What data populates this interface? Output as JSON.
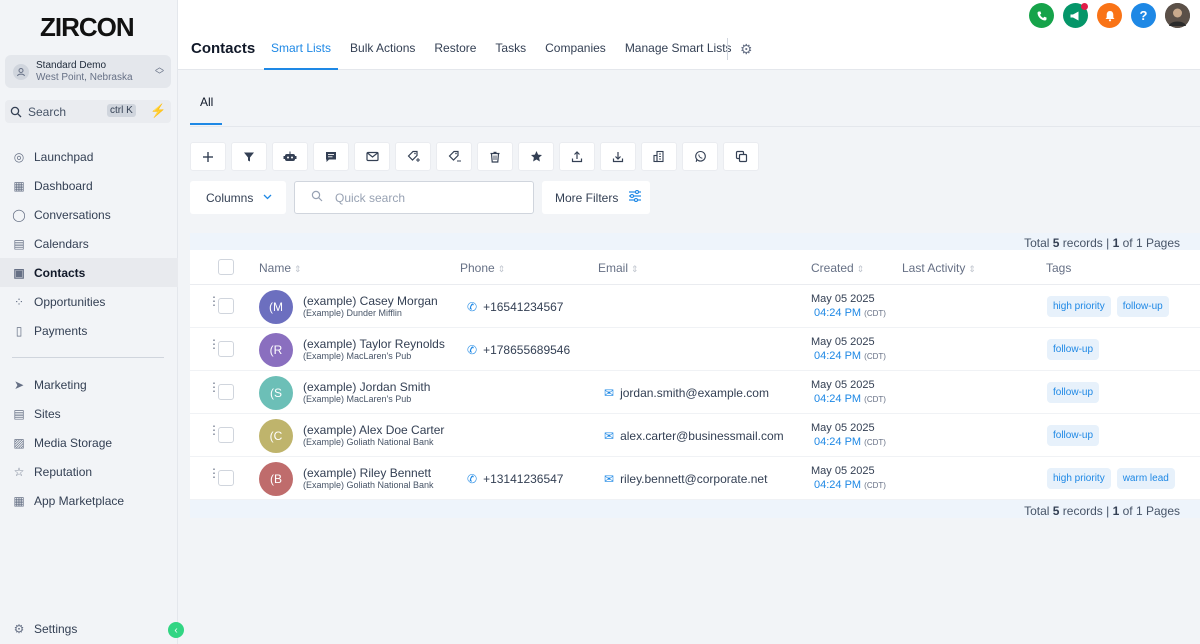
{
  "brand": {
    "logo": "ZIRCON"
  },
  "account": {
    "name": "Standard Demo",
    "location": "West Point, Nebraska"
  },
  "search": {
    "label": "Search",
    "shortcut": "ctrl K"
  },
  "sidebar": {
    "items": [
      {
        "label": "Launchpad",
        "icon": "rocket-icon"
      },
      {
        "label": "Dashboard",
        "icon": "grid-icon"
      },
      {
        "label": "Conversations",
        "icon": "chat-icon"
      },
      {
        "label": "Calendars",
        "icon": "calendar-icon"
      },
      {
        "label": "Contacts",
        "icon": "contacts-icon",
        "active": true
      },
      {
        "label": "Opportunities",
        "icon": "pipeline-icon"
      },
      {
        "label": "Payments",
        "icon": "receipt-icon"
      }
    ],
    "items2": [
      {
        "label": "Marketing",
        "icon": "send-icon"
      },
      {
        "label": "Sites",
        "icon": "sites-icon"
      },
      {
        "label": "Media Storage",
        "icon": "image-icon"
      },
      {
        "label": "Reputation",
        "icon": "star-icon"
      },
      {
        "label": "App Marketplace",
        "icon": "apps-icon"
      }
    ],
    "settings": "Settings"
  },
  "header": {
    "title": "Contacts",
    "tabs": [
      "Smart Lists",
      "Bulk Actions",
      "Restore",
      "Tasks",
      "Companies",
      "Manage Smart Lists"
    ]
  },
  "subtabs": {
    "all": "All"
  },
  "toolbar": {
    "icons": [
      "add-icon",
      "filter-icon",
      "robot-icon",
      "message-icon",
      "email-icon",
      "add-tag-icon",
      "remove-tag-icon",
      "delete-icon",
      "star-icon",
      "export-icon",
      "import-icon",
      "company-icon",
      "whatsapp-icon",
      "duplicate-icon"
    ]
  },
  "filters": {
    "columns": "Columns",
    "quick_search_placeholder": "Quick search",
    "more_filters": "More Filters"
  },
  "totals": {
    "prefix": "Total ",
    "count": "5",
    "mid": " records | ",
    "page": "1",
    "suffix": " of 1 Pages"
  },
  "table": {
    "headers": {
      "name": "Name",
      "phone": "Phone",
      "email": "Email",
      "created": "Created",
      "last_activity": "Last Activity",
      "tags": "Tags"
    },
    "rows": [
      {
        "initials": "(M",
        "color": "#6c6fbf",
        "name": "(example) Casey Morgan",
        "company": "(Example) Dunder Mifflin",
        "phone": "+16541234567",
        "email": "",
        "date": "May 05 2025",
        "time": "04:24 PM",
        "tz": "(CDT)",
        "tags": [
          "high priority",
          "follow-up"
        ]
      },
      {
        "initials": "(R",
        "color": "#8a6fbf",
        "name": "(example) Taylor Reynolds",
        "company": "(Example) MacLaren's Pub",
        "phone": "+178655689546",
        "email": "",
        "date": "May 05 2025",
        "time": "04:24 PM",
        "tz": "(CDT)",
        "tags": [
          "follow-up"
        ]
      },
      {
        "initials": "(S",
        "color": "#6cbfb7",
        "name": "(example) Jordan Smith",
        "company": "(Example) MacLaren's Pub",
        "phone": "",
        "email": "jordan.smith@example.com",
        "date": "May 05 2025",
        "time": "04:24 PM",
        "tz": "(CDT)",
        "tags": [
          "follow-up"
        ]
      },
      {
        "initials": "(C",
        "color": "#bfb46c",
        "name": "(example) Alex Doe Carter",
        "company": "(Example) Goliath National Bank",
        "phone": "",
        "email": "alex.carter@businessmail.com",
        "date": "May 05 2025",
        "time": "04:24 PM",
        "tz": "(CDT)",
        "tags": [
          "follow-up"
        ]
      },
      {
        "initials": "(B",
        "color": "#bf6c6c",
        "name": "(example) Riley Bennett",
        "company": "(Example) Goliath National Bank",
        "phone": "+13141236547",
        "email": "riley.bennett@corporate.net",
        "date": "May 05 2025",
        "time": "04:24 PM",
        "tz": "(CDT)",
        "tags": [
          "high priority",
          "warm lead"
        ]
      }
    ]
  }
}
